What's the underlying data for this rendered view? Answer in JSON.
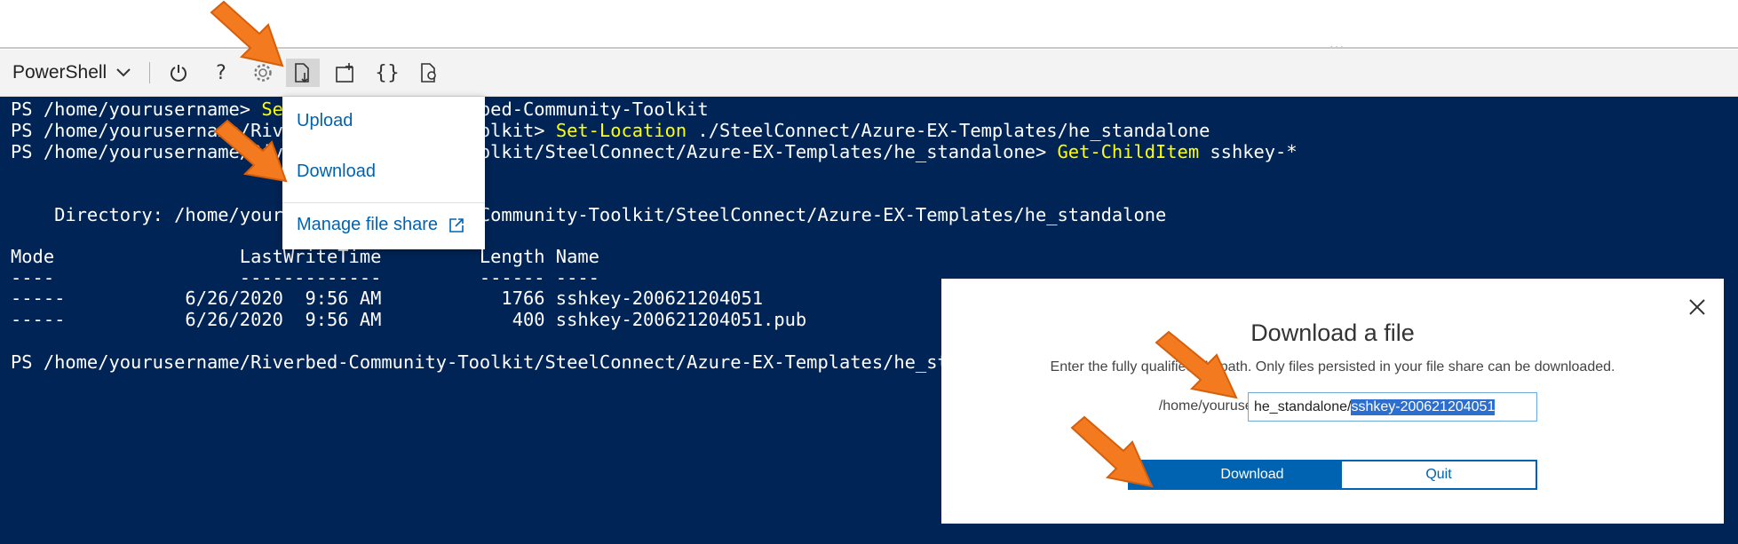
{
  "toolbar": {
    "shell": "PowerShell",
    "buttons": [
      "restart-icon",
      "help-icon",
      "settings-icon",
      "upload-download-icon",
      "new-session-icon",
      "editor-icon",
      "web-preview-icon"
    ]
  },
  "file_menu": {
    "upload": "Upload",
    "download": "Download",
    "manage": "Manage file share"
  },
  "terminal": {
    "lines": [
      {
        "prompt": "PS /home/yourusername> ",
        "cmd": "Set-Location",
        "arg": " ./Riverbed-Community-Toolkit"
      },
      {
        "prompt": "PS /home/yourusername/Riverbed-Community-Toolkit> ",
        "cmd": "Set-Location",
        "arg": " ./SteelConnect/Azure-EX-Templates/he_standalone"
      },
      {
        "prompt": "PS /home/yourusername/Riverbed-Community-Toolkit/SteelConnect/Azure-EX-Templates/he_standalone> ",
        "cmd": "Get-ChildItem",
        "arg": " sshkey-*"
      }
    ],
    "directory": "    Directory: /home/yourusername/Riverbed-Community-Toolkit/SteelConnect/Azure-EX-Templates/he_standalone",
    "header": "Mode                 LastWriteTime         Length Name",
    "underline": "----                 -------------         ------ ----",
    "rows": [
      "-----           6/26/2020  9:56 AM           1766 sshkey-200621204051",
      "-----           6/26/2020  9:56 AM            400 sshkey-200621204051.pub"
    ],
    "final_prompt": "PS /home/yourusername/Riverbed-Community-Toolkit/SteelConnect/Azure-EX-Templates/he_standalone>"
  },
  "dialog": {
    "title": "Download a file",
    "description": "Enter the fully qualified file path. Only files persisted in your file share can be downloaded.",
    "path_prefix": "/home/yourusername",
    "input_plain": "he_standalone/",
    "input_selected": "sshkey-200621204051",
    "download_label": "Download",
    "quit_label": "Quit"
  },
  "colors": {
    "terminal_bg": "#012456",
    "accent": "#0063b1",
    "command": "#ffff00",
    "arrow": "#f47a20"
  }
}
